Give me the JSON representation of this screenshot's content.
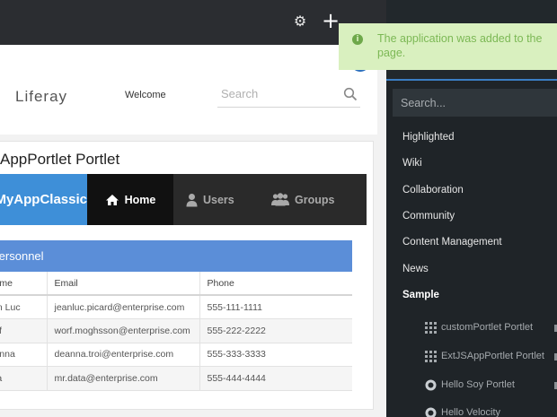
{
  "topbar": {
    "settings_icon": "gear-icon",
    "add_icon": "plus-icon"
  },
  "header": {
    "logo": "Liferay",
    "welcome": "Welcome",
    "search_placeholder": "Search"
  },
  "portlet": {
    "title": "AppPortlet Portlet",
    "brand": "MyAppClassic",
    "nav": [
      {
        "label": "Home",
        "icon": "home-icon"
      },
      {
        "label": "Users",
        "icon": "user-icon"
      },
      {
        "label": "Groups",
        "icon": "group-icon"
      }
    ],
    "panel_title": "Personnel",
    "columns": [
      "Name",
      "Email",
      "Phone"
    ],
    "rows": [
      {
        "name": "Jean Luc",
        "email": "jeanluc.picard@enterprise.com",
        "phone": "555-111-1111"
      },
      {
        "name": "Worf",
        "email": "worf.moghsson@enterprise.com",
        "phone": "555-222-2222"
      },
      {
        "name": "Deanna",
        "email": "deanna.troi@enterprise.com",
        "phone": "555-333-3333"
      },
      {
        "name": "Data",
        "email": "mr.data@enterprise.com",
        "phone": "555-444-4444"
      }
    ]
  },
  "sidebar": {
    "search_placeholder": "Search...",
    "categories": [
      "Highlighted",
      "Wiki",
      "Collaboration",
      "Community",
      "Content Management",
      "News",
      "Sample"
    ],
    "apps": [
      {
        "label": "customPortlet Portlet",
        "icon": "grid-icon"
      },
      {
        "label": "ExtJSAppPortlet Portlet",
        "icon": "grid-icon"
      },
      {
        "label": "Hello Soy Portlet",
        "icon": "circle-icon"
      },
      {
        "label": "Hello Velocity",
        "icon": "circle-icon"
      }
    ]
  },
  "toast": {
    "message": "The application was added to the page.",
    "icon": "info-icon"
  },
  "colors": {
    "accent": "#3e8fd8",
    "panel": "#5b8ed8",
    "sidebar": "#1f2428",
    "toast_bg": "#d9f0bf",
    "toast_text": "#7cb855"
  }
}
